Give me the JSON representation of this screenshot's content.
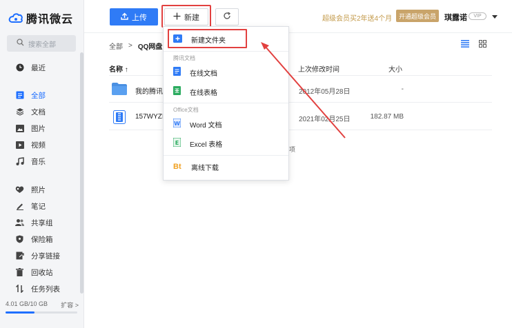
{
  "app": {
    "logo_text": "腾讯微云"
  },
  "sidebar": {
    "search_placeholder": "搜索全部",
    "items": [
      {
        "label": "最近",
        "icon": "clock-icon",
        "active": false
      },
      {
        "label": "全部",
        "icon": "all-files-icon",
        "active": true
      },
      {
        "label": "文档",
        "icon": "layers-icon",
        "active": false
      },
      {
        "label": "图片",
        "icon": "image-icon",
        "active": false
      },
      {
        "label": "视频",
        "icon": "video-icon",
        "active": false
      },
      {
        "label": "音乐",
        "icon": "music-icon",
        "active": false
      },
      {
        "label": "照片",
        "icon": "photo-icon",
        "active": false
      },
      {
        "label": "笔记",
        "icon": "pen-icon",
        "active": false
      },
      {
        "label": "共享组",
        "icon": "group-icon",
        "active": false
      },
      {
        "label": "保险箱",
        "icon": "shield-icon",
        "active": false
      },
      {
        "label": "分享链接",
        "icon": "share-link-icon",
        "active": false
      },
      {
        "label": "回收站",
        "icon": "trash-icon",
        "active": false
      },
      {
        "label": "任务列表",
        "icon": "transfer-icon",
        "active": false
      }
    ],
    "storage": {
      "used_text": "4.01 GB/10 GB",
      "expand_label": "扩容 >",
      "used_fraction": 0.401
    }
  },
  "toolbar": {
    "upload_label": "上传",
    "new_label": "新建",
    "promo_text": "超级会员买2年送4个月",
    "vip_button": "开通超级会员",
    "user_name": "琪露诺",
    "vip_tag": "VIP"
  },
  "breadcrumb": {
    "root": "全部",
    "separator": ">",
    "current": "QQ网盘"
  },
  "table": {
    "headers": {
      "name": "名称 ↑",
      "date": "上次修改时间",
      "size": "大小"
    },
    "rows": [
      {
        "name": "我的腾讯",
        "date": "2012年05月28日",
        "size": "-",
        "type": "folder"
      },
      {
        "name": "157WYZI",
        "date": "2021年02月25日",
        "size": "182.87 MB",
        "type": "file"
      }
    ],
    "footer_partial": "项"
  },
  "menu": {
    "new_folder": "新建文件夹",
    "group_tencent_docs": "腾讯文档",
    "online_doc": "在线文档",
    "online_sheet": "在线表格",
    "group_office": "Office文档",
    "word_doc": "Word 文档",
    "excel_sheet": "Excel 表格",
    "offline_download": "离线下载",
    "bt_glyph": "Bt"
  },
  "colors": {
    "accent": "#2f7bf6",
    "highlight_red": "#e2403f",
    "vip_gold": "#c9a46a"
  }
}
